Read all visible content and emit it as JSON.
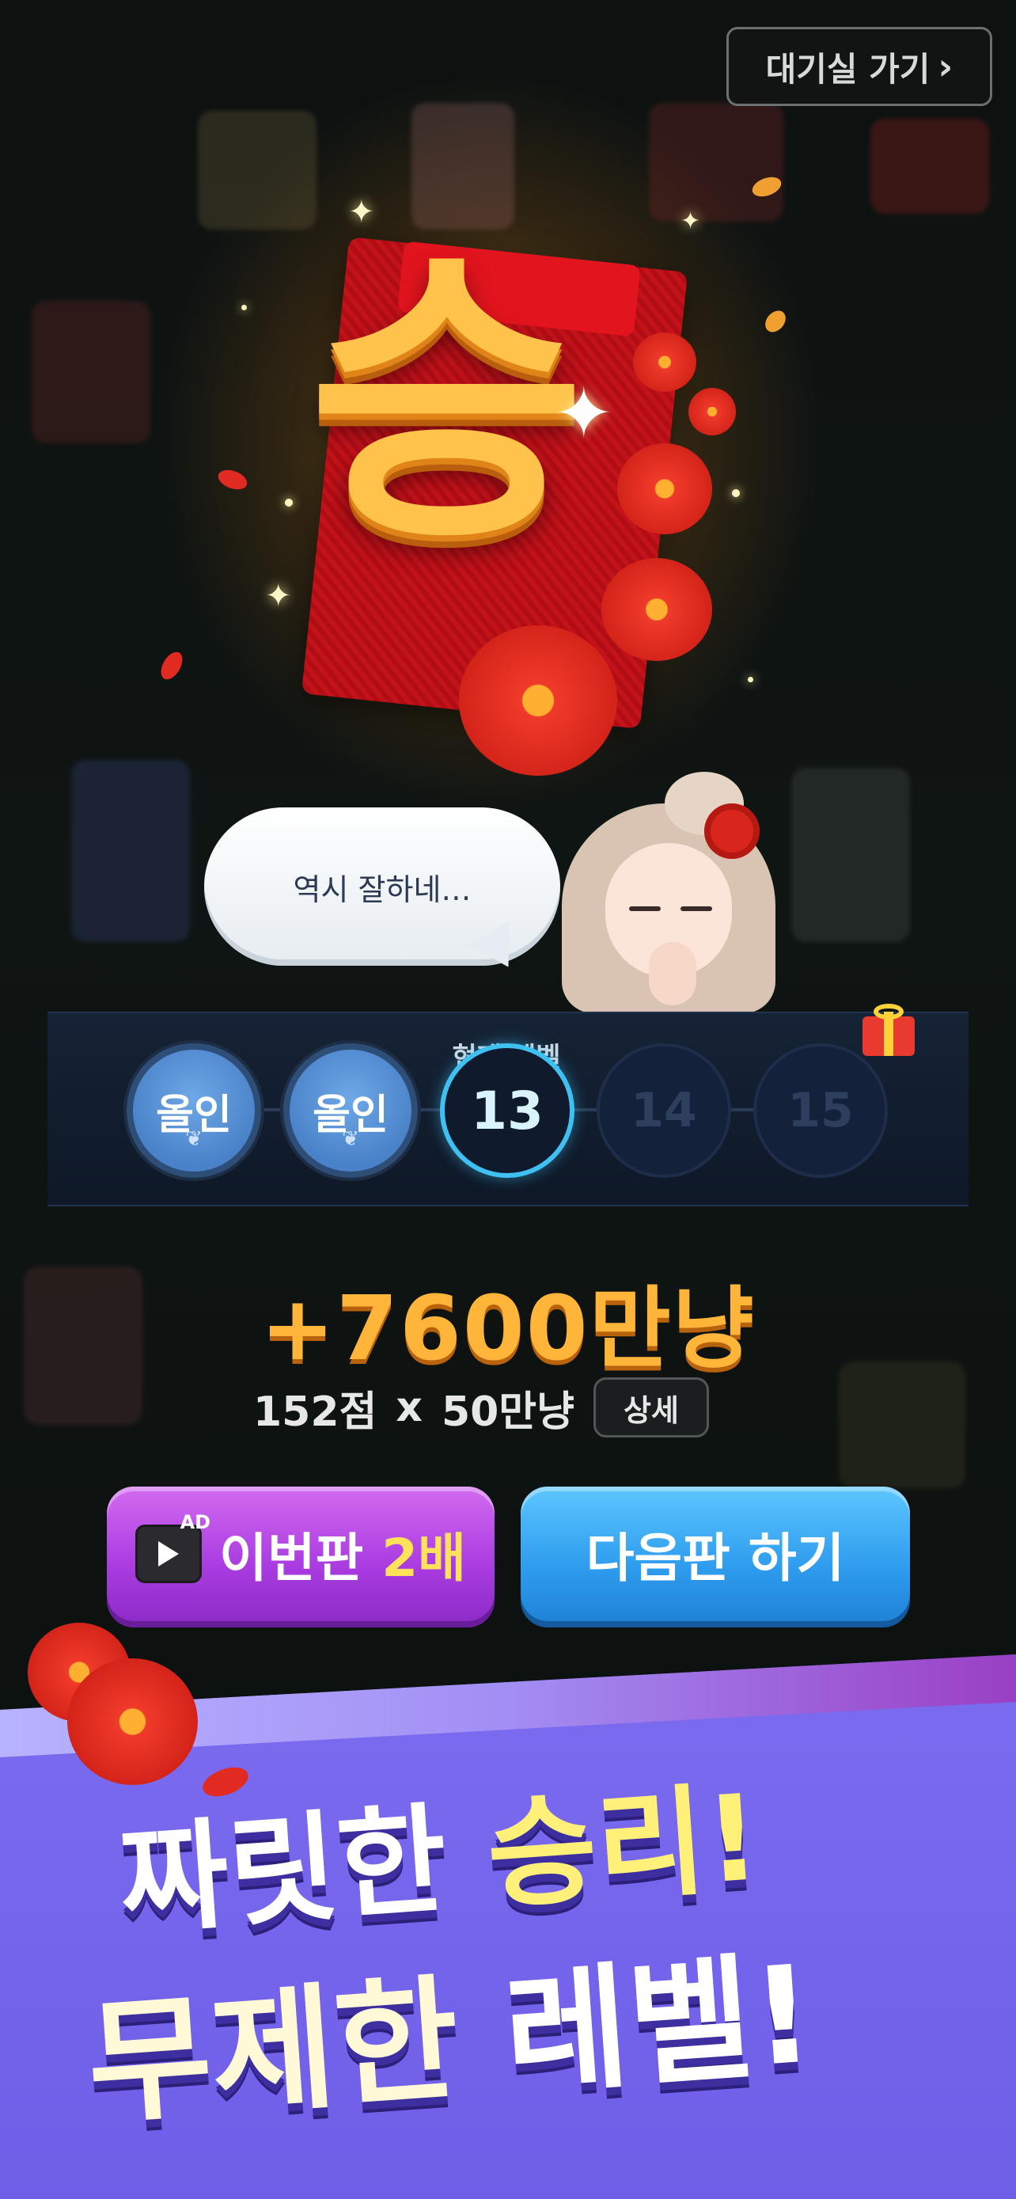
{
  "header": {
    "lobby_button": {
      "label": "대기실 가기",
      "icon": "chevron-right-icon"
    }
  },
  "result": {
    "title": "승"
  },
  "dialog": {
    "speech": "역시 잘하네…"
  },
  "level_progress": {
    "current_label": "현재 레벨",
    "steps": [
      {
        "label": "올인",
        "state": "completed"
      },
      {
        "label": "올인",
        "state": "completed"
      },
      {
        "label": "13",
        "state": "current"
      },
      {
        "label": "14",
        "state": "locked"
      },
      {
        "label": "15",
        "state": "locked",
        "reward_icon": "gift-icon"
      }
    ]
  },
  "reward": {
    "amount": "+7600만냥",
    "score": "152점",
    "times": "x",
    "multiplier": "50만냥",
    "detail_label": "상세"
  },
  "actions": {
    "ad_double": {
      "ad_badge": "AD",
      "label": "이번판",
      "highlight": "2배"
    },
    "next_game": {
      "label": "다음판 하기"
    }
  },
  "promo": {
    "line1_a": "짜릿한",
    "line1_b": "승리!",
    "line2_a": "무제한",
    "line2_b": "레벨!"
  },
  "colors": {
    "accent_gold": "#ffb43a",
    "purple_button": "#a93be0",
    "blue_button": "#2f9cee",
    "banner": "#7565ec",
    "current_ring": "#3ec1f0"
  }
}
